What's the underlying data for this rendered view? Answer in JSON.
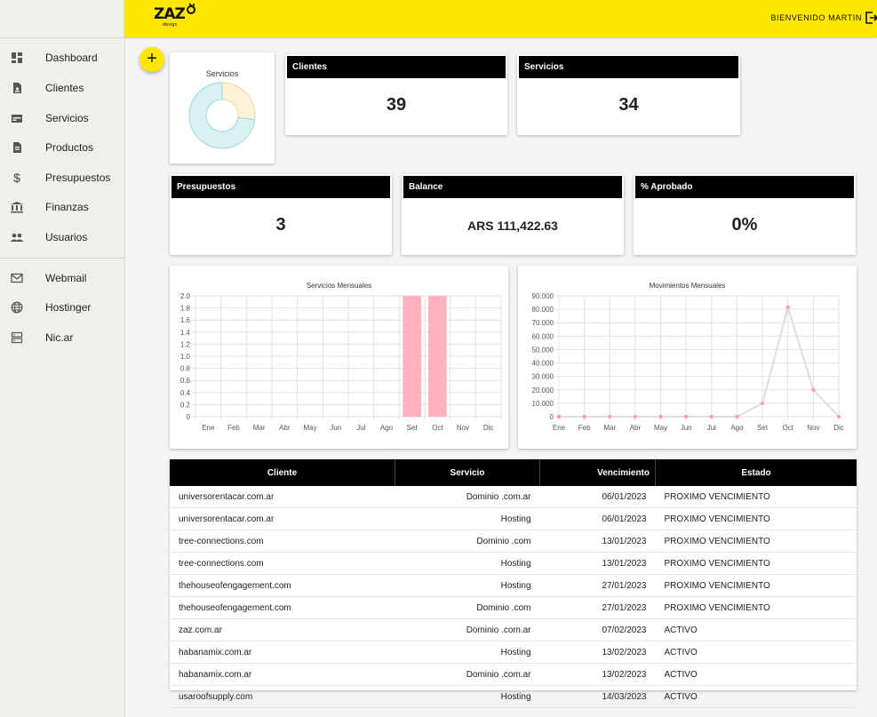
{
  "app": {
    "logo": "ZAZ",
    "logo_sub": "design",
    "welcome": "BIENVENIDO MARTIN"
  },
  "colors": {
    "accent": "#ffe600",
    "header_bg": "#000000",
    "bar": "#ffb1c1",
    "line": "#dddddd",
    "point": "#ff9bb0"
  },
  "sidebar": {
    "items": [
      {
        "label": "Dashboard",
        "icon": "dashboard-icon"
      },
      {
        "label": "Clientes",
        "icon": "client-icon"
      },
      {
        "label": "Servicios",
        "icon": "service-icon"
      },
      {
        "label": "Productos",
        "icon": "product-icon"
      },
      {
        "label": "Presupuestos",
        "icon": "dollar-icon"
      },
      {
        "label": "Finanzas",
        "icon": "bank-icon"
      },
      {
        "label": "Usuarios",
        "icon": "users-icon"
      }
    ],
    "links": [
      {
        "label": "Webmail",
        "icon": "mail-icon"
      },
      {
        "label": "Hostinger",
        "icon": "globe-icon"
      },
      {
        "label": "Nic.ar",
        "icon": "server-icon"
      }
    ]
  },
  "fab": {
    "label": "+"
  },
  "donut": {
    "title": "Servicios"
  },
  "stats": [
    {
      "label": "Clientes",
      "value": "39"
    },
    {
      "label": "Servicios",
      "value": "34"
    },
    {
      "label": "Presupuestos",
      "value": "3"
    },
    {
      "label": "Balance",
      "value": "ARS 111,422.63"
    },
    {
      "label": "% Aprobado",
      "value": "0%"
    }
  ],
  "chart_data": [
    {
      "type": "pie",
      "title": "Servicios",
      "values": [
        0.27,
        0.73
      ],
      "colors": [
        "#fff2d6",
        "#d8f1f1"
      ]
    },
    {
      "type": "bar",
      "title": "Servicios Mensuales",
      "categories": [
        "Ene",
        "Feb",
        "Mar",
        "Abr",
        "May",
        "Jun",
        "Jul",
        "Ago",
        "Set",
        "Oct",
        "Nov",
        "Dic"
      ],
      "values": [
        0,
        0,
        0,
        0,
        0,
        0,
        0,
        0,
        2,
        2,
        0,
        0
      ],
      "ylim": [
        0,
        2.0
      ],
      "yticks": [
        "2.0",
        "1.8",
        "1.6",
        "1.4",
        "1.2",
        "1.0",
        "0.8",
        "0.6",
        "0.4",
        "0.2",
        "0"
      ],
      "grid": true
    },
    {
      "type": "line",
      "title": "Movimientos Mensuales",
      "categories": [
        "Ene",
        "Feb",
        "Mar",
        "Abr",
        "May",
        "Jun",
        "Jul",
        "Ago",
        "Set",
        "Oct",
        "Nov",
        "Dic"
      ],
      "values": [
        0,
        0,
        0,
        0,
        0,
        0,
        0,
        0,
        10000,
        81500,
        20000,
        0
      ],
      "ylim": [
        0,
        90000
      ],
      "yticks": [
        "90.000",
        "80.000",
        "70.000",
        "60.000",
        "50.000",
        "40.000",
        "30.000",
        "20.000",
        "10.000",
        "0"
      ],
      "grid": true
    }
  ],
  "table": {
    "headers": [
      "Cliente",
      "Servicio",
      "Vencimiento",
      "Estado"
    ],
    "rows": [
      [
        "universorentacar.com.ar",
        "Dominio .com.ar",
        "06/01/2023",
        "PROXIMO VENCIMIENTO"
      ],
      [
        "universorentacar.com.ar",
        "Hosting",
        "06/01/2023",
        "PROXIMO VENCIMIENTO"
      ],
      [
        "tree-connections.com",
        "Dominio .com",
        "13/01/2023",
        "PROXIMO VENCIMIENTO"
      ],
      [
        "tree-connections.com",
        "Hosting",
        "13/01/2023",
        "PROXIMO VENCIMIENTO"
      ],
      [
        "thehouseofengagement.com",
        "Hosting",
        "27/01/2023",
        "PROXIMO VENCIMIENTO"
      ],
      [
        "thehouseofengagement.com",
        "Dominio .com",
        "27/01/2023",
        "PROXIMO VENCIMIENTO"
      ],
      [
        "zaz.com.ar",
        "Dominio .com.ar",
        "07/02/2023",
        "ACTIVO"
      ],
      [
        "habanamix.com.ar",
        "Hosting",
        "13/02/2023",
        "ACTIVO"
      ],
      [
        "habanamix.com.ar",
        "Dominio .com.ar",
        "13/02/2023",
        "ACTIVO"
      ],
      [
        "usaroofsupply.com",
        "Hosting",
        "14/03/2023",
        "ACTIVO"
      ]
    ]
  }
}
